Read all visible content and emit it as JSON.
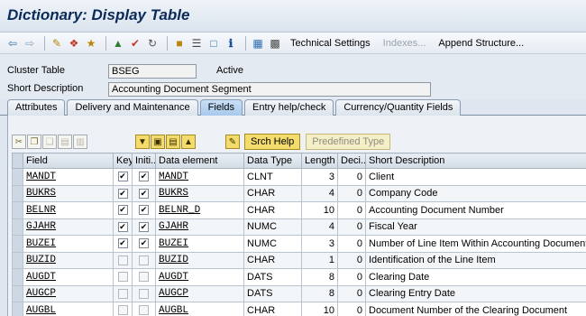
{
  "window": {
    "title": "Dictionary: Display Table"
  },
  "toolbar": {
    "technical_settings": "Technical Settings",
    "indexes": "Indexes...",
    "append_structure": "Append Structure..."
  },
  "form": {
    "table_type_label": "Cluster Table",
    "table_name": "BSEG",
    "status": "Active",
    "short_desc_label": "Short Description",
    "short_desc_value": "Accounting Document Segment"
  },
  "tabs": [
    {
      "label": "Attributes"
    },
    {
      "label": "Delivery and Maintenance"
    },
    {
      "label": "Fields"
    },
    {
      "label": "Entry help/check"
    },
    {
      "label": "Currency/Quantity Fields"
    }
  ],
  "panel": {
    "srch_help": "Srch Help",
    "predefined_type": "Predefined Type"
  },
  "grid": {
    "headers": {
      "field": "Field",
      "key": "Key",
      "initial": "Initi...",
      "data_element": "Data element",
      "data_type": "Data Type",
      "length": "Length",
      "decimals": "Deci...",
      "short_description": "Short Description"
    },
    "rows": [
      {
        "field": "MANDT",
        "key": true,
        "initial": true,
        "data_element": "MANDT",
        "data_type": "CLNT",
        "length": "3",
        "decimals": "0",
        "desc": "Client"
      },
      {
        "field": "BUKRS",
        "key": true,
        "initial": true,
        "data_element": "BUKRS",
        "data_type": "CHAR",
        "length": "4",
        "decimals": "0",
        "desc": "Company Code"
      },
      {
        "field": "BELNR",
        "key": true,
        "initial": true,
        "data_element": "BELNR_D",
        "data_type": "CHAR",
        "length": "10",
        "decimals": "0",
        "desc": "Accounting Document Number"
      },
      {
        "field": "GJAHR",
        "key": true,
        "initial": true,
        "data_element": "GJAHR",
        "data_type": "NUMC",
        "length": "4",
        "decimals": "0",
        "desc": "Fiscal Year"
      },
      {
        "field": "BUZEI",
        "key": true,
        "initial": true,
        "data_element": "BUZEI",
        "data_type": "NUMC",
        "length": "3",
        "decimals": "0",
        "desc": "Number of Line Item Within Accounting Document"
      },
      {
        "field": "BUZID",
        "key": false,
        "initial": false,
        "data_element": "BUZID",
        "data_type": "CHAR",
        "length": "1",
        "decimals": "0",
        "desc": "Identification of the Line Item"
      },
      {
        "field": "AUGDT",
        "key": false,
        "initial": false,
        "data_element": "AUGDT",
        "data_type": "DATS",
        "length": "8",
        "decimals": "0",
        "desc": "Clearing Date"
      },
      {
        "field": "AUGCP",
        "key": false,
        "initial": false,
        "data_element": "AUGCP",
        "data_type": "DATS",
        "length": "8",
        "decimals": "0",
        "desc": "Clearing Entry Date"
      },
      {
        "field": "AUGBL",
        "key": false,
        "initial": false,
        "data_element": "AUGBL",
        "data_type": "CHAR",
        "length": "10",
        "decimals": "0",
        "desc": "Document Number of the Clearing Document"
      }
    ]
  }
}
